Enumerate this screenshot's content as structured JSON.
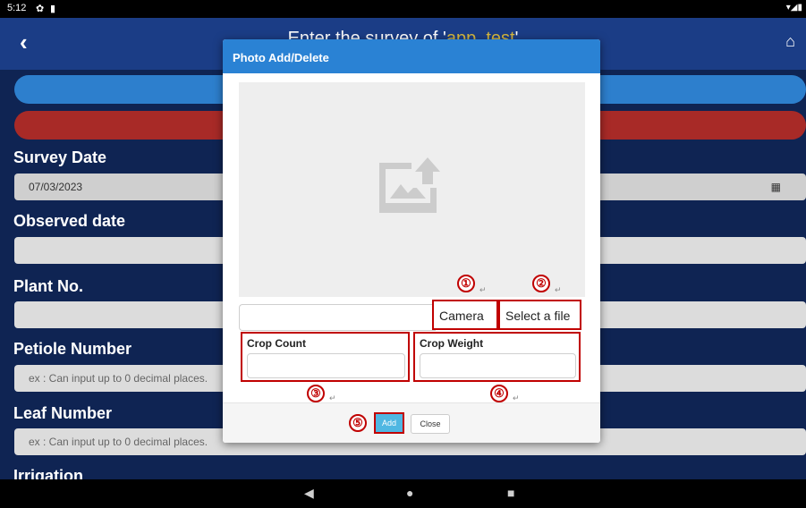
{
  "status_bar": {
    "time": "5:12"
  },
  "header": {
    "title_prefix": "Enter the survey of '",
    "project": "app_test",
    "title_suffix": "'"
  },
  "form": {
    "survey_date": {
      "label": "Survey Date",
      "value": "07/03/2023"
    },
    "observed_date": {
      "label": "Observed date"
    },
    "plant_no": {
      "label": "Plant No."
    },
    "petiole_number": {
      "label": "Petiole Number",
      "placeholder": "ex : Can input up to 0 decimal places."
    },
    "leaf_number": {
      "label": "Leaf Number",
      "placeholder": "ex : Can input up to 0 decimal places."
    },
    "irrigation": {
      "label": "Irrigation"
    }
  },
  "modal": {
    "title": "Photo Add/Delete",
    "camera_label": "Camera",
    "select_file_label": "Select a file",
    "crop_count_label": "Crop Count",
    "crop_weight_label": "Crop Weight",
    "add_label": "Add",
    "close_label": "Close",
    "markers": [
      "①",
      "②",
      "③",
      "④",
      "⑤"
    ]
  },
  "icons": {
    "back": "chevron-left-icon",
    "home": "home-icon",
    "calendar": "calendar-icon",
    "photo_upload": "image-upload-icon"
  },
  "colors": {
    "background": "#0f2453",
    "header": "#1b3d86",
    "modal_header": "#2a82d4",
    "annotation_red": "#c00000",
    "add_button": "#4fb7e2"
  }
}
